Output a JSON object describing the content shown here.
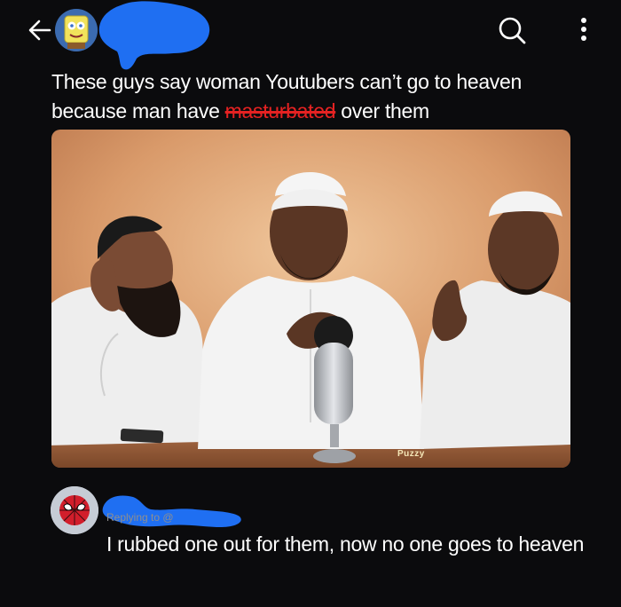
{
  "header": {
    "back_icon": "arrow-left-icon",
    "handle_prefix": "@",
    "search_icon": "search-icon",
    "more_icon": "more-vertical-icon"
  },
  "post": {
    "text_before": "These guys say woman Youtubers can’t go to heaven because man have ",
    "struck_word": "masturbated",
    "text_after": " over them",
    "strike_color": "#e52222",
    "media": {
      "watermark": "Puzzy"
    }
  },
  "reply": {
    "replying_prefix": "Replying to @",
    "text": "I rubbed one out for them, now no one goes to heaven"
  },
  "colors": {
    "background": "#0b0b0d",
    "redaction_blue": "#1f6ff2",
    "muted_text": "#8f8f8f"
  }
}
